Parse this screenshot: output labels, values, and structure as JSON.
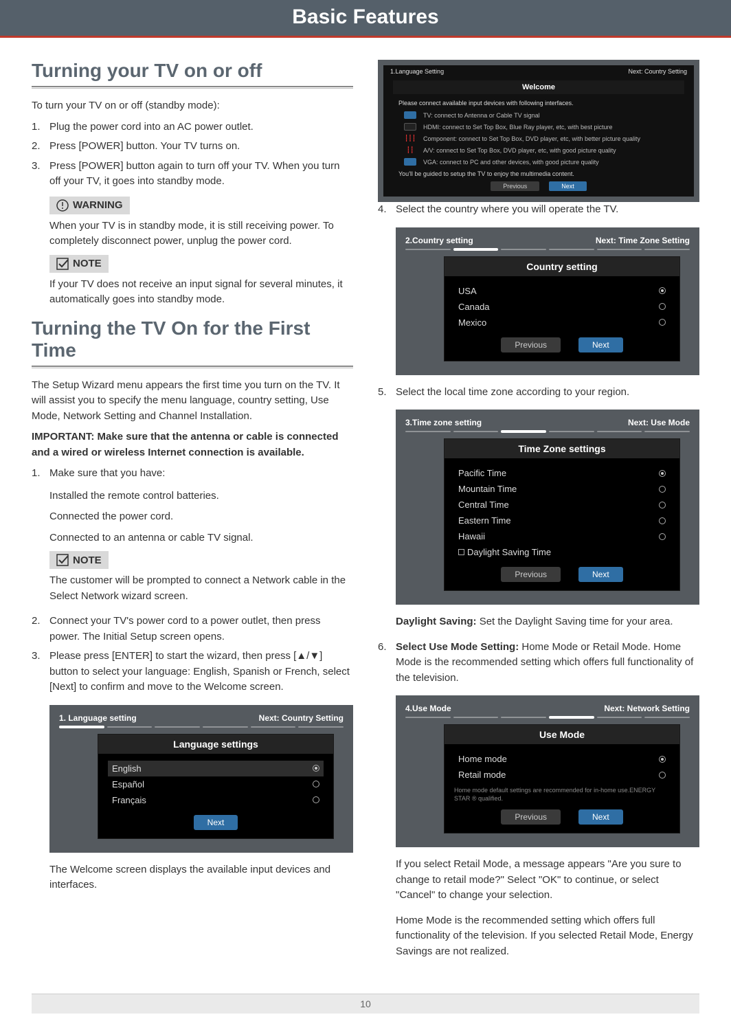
{
  "header": {
    "title": "Basic Features"
  },
  "page_number": "10",
  "section1": {
    "title": "Turning your TV on or off",
    "intro": "To turn your TV on or off (standby mode):",
    "steps": [
      "Plug the power cord into an AC power outlet.",
      "Press [POWER] button. Your TV turns on.",
      "Press [POWER] button again to turn off your TV. When you turn off your TV, it goes into standby mode."
    ],
    "warning_label": "WARNING",
    "warning_text": "When your TV is in standby mode, it is still receiving power. To completely disconnect power, unplug the power cord.",
    "note_label": "NOTE",
    "note_text": "If your TV does not receive an input signal for several minutes, it automatically goes into standby mode."
  },
  "section2": {
    "title": "Turning the TV On for the First Time",
    "p1": "The Setup Wizard menu appears the first time you turn on the TV. It will assist you to specify the menu language, country setting, Use Mode, Network Setting and Channel Installation.",
    "important": "IMPORTANT: Make sure that the antenna or cable is connected and a wired or wireless Internet connection is available.",
    "steps": [
      "Make sure that you have:",
      "Connect your TV's power cord to a power outlet, then press power. The Initial Setup screen opens.",
      "Please press [ENTER] to start the wizard, then press [▲/▼] button to select your language: English, Spanish or French, select [Next] to confirm and move to the Welcome screen."
    ],
    "sub1": [
      "Installed the remote control batteries.",
      "Connected the power cord.",
      "Connected to an antenna or cable TV signal."
    ],
    "note2_label": "NOTE",
    "note2_text": "The customer will be prompted to connect a Network cable in the Select Network wizard screen.",
    "after3": "The Welcome screen displays the available input devices and interfaces."
  },
  "lang_shot": {
    "step": "1. Language setting",
    "next": "Next: Country Setting",
    "box_title": "Language settings",
    "options": [
      "English",
      "Español",
      "Français"
    ],
    "selected": 0,
    "next_btn": "Next"
  },
  "welcome_shot": {
    "step": "1.Language Setting",
    "next": "Next: Country Setting",
    "title": "Welcome",
    "lead": "Please connect available input devices with following interfaces.",
    "rows": [
      "TV: connect to Antenna or Cable TV signal",
      "HDMI: connect to Set Top Box, Blue Ray player, etc, with best picture",
      "Component: connect to Set Top Box, DVD player, etc, with better picture quality",
      "A/V: connect to Set Top Box, DVD player, etc, with good picture quality",
      "VGA: connect to PC and other devices, with good picture quality"
    ],
    "foot": "You'll be guided to setup the TV to enjoy the multimedia content.",
    "prev": "Previous",
    "nxt": "Next"
  },
  "right_steps": {
    "s4": "Select the country where you will operate the TV.",
    "s5": "Select the local time zone according to your region.",
    "ds_label": "Daylight Saving:",
    "ds_text": " Set the Daylight Saving time for your area.",
    "s6a": "Select Use Mode Setting:",
    "s6b": " Home Mode or Retail Mode. Home Mode is the recommended setting which offers full functionality of the television.",
    "retail1": "If you select Retail Mode, a message appears \"Are you sure to change to retail mode?\" Select \"OK\" to continue, or select \"Cancel\" to change your selection.",
    "retail2": "Home Mode is the recommended setting which offers full functionality of the television. If you selected Retail Mode, Energy Savings are not realized."
  },
  "country_shot": {
    "step": "2.Country setting",
    "next": "Next: Time Zone Setting",
    "box_title": "Country setting",
    "options": [
      "USA",
      "Canada",
      "Mexico"
    ],
    "selected": 0,
    "prev": "Previous",
    "nxt": "Next"
  },
  "tz_shot": {
    "step": "3.Time zone setting",
    "next": "Next: Use Mode",
    "box_title": "Time Zone settings",
    "options": [
      "Pacific Time",
      "Mountain Time",
      "Central Time",
      "Eastern Time",
      "Hawaii"
    ],
    "dst": "Daylight Saving Time",
    "selected": 0,
    "prev": "Previous",
    "nxt": "Next"
  },
  "use_shot": {
    "step": "4.Use Mode",
    "next": "Next: Network Setting",
    "box_title": "Use Mode",
    "options": [
      "Home mode",
      "Retail mode"
    ],
    "selected": 0,
    "hint": "Home mode default settings are recommended for in-home use.ENERGY STAR ® qualified.",
    "prev": "Previous",
    "nxt": "Next"
  }
}
